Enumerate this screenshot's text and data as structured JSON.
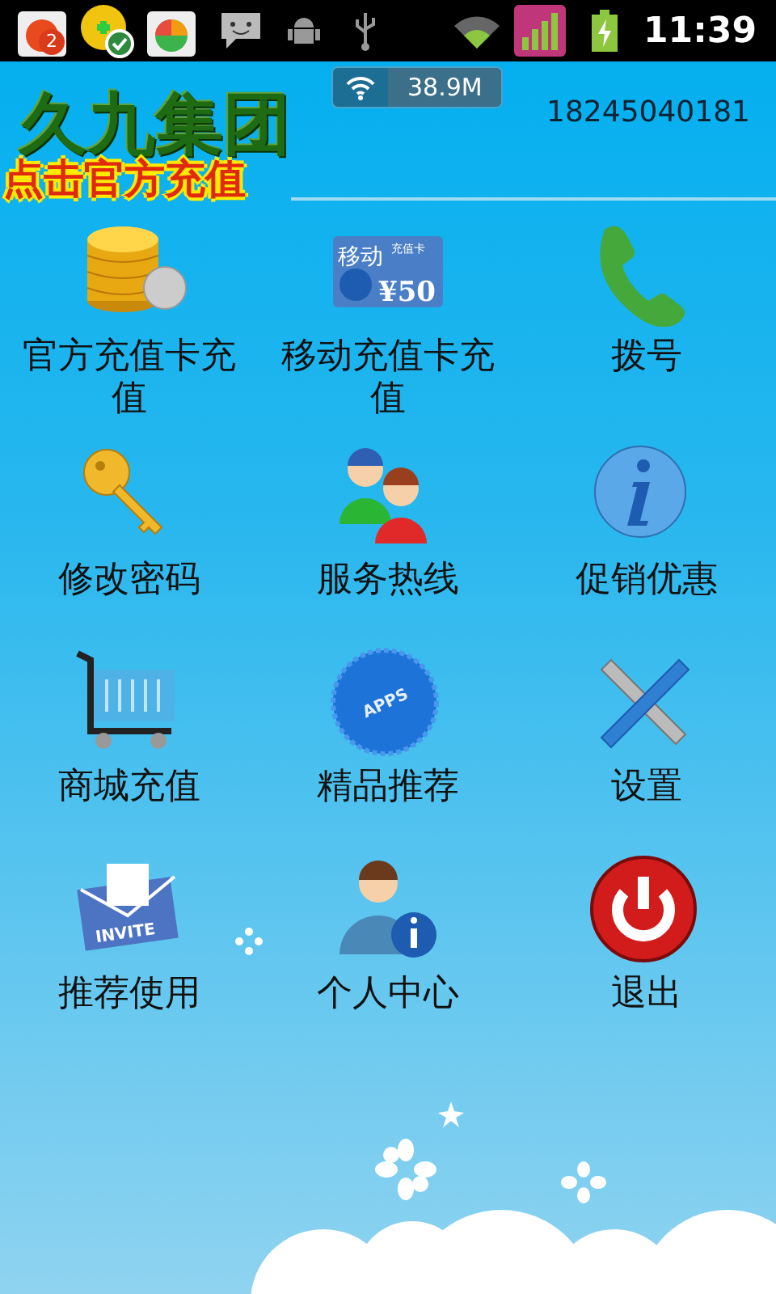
{
  "status_bar": {
    "notification_badge": "2",
    "time": "11:39"
  },
  "header": {
    "network_speed": "38.9M",
    "phone_number": "18245040181",
    "logo": "久九集团",
    "promo": "点击官方充值"
  },
  "menu": [
    {
      "kind": "coins",
      "label": "官方充值卡充值"
    },
    {
      "kind": "card",
      "label": "移动充值卡充值",
      "icon_text": [
        "移动",
        "充值卡",
        "¥50"
      ]
    },
    {
      "kind": "phone",
      "label": "拨号"
    },
    {
      "kind": "key",
      "label": "修改密码"
    },
    {
      "kind": "people",
      "label": "服务热线"
    },
    {
      "kind": "info",
      "label": "促销优惠"
    },
    {
      "kind": "cart",
      "label": "商城充值"
    },
    {
      "kind": "apps",
      "label": "精品推荐",
      "icon_text": [
        "APPS"
      ]
    },
    {
      "kind": "tools",
      "label": "设置"
    },
    {
      "kind": "invite",
      "label": "推荐使用",
      "icon_text": [
        "INVITE"
      ]
    },
    {
      "kind": "user",
      "label": "个人中心"
    },
    {
      "kind": "power",
      "label": "退出"
    }
  ]
}
